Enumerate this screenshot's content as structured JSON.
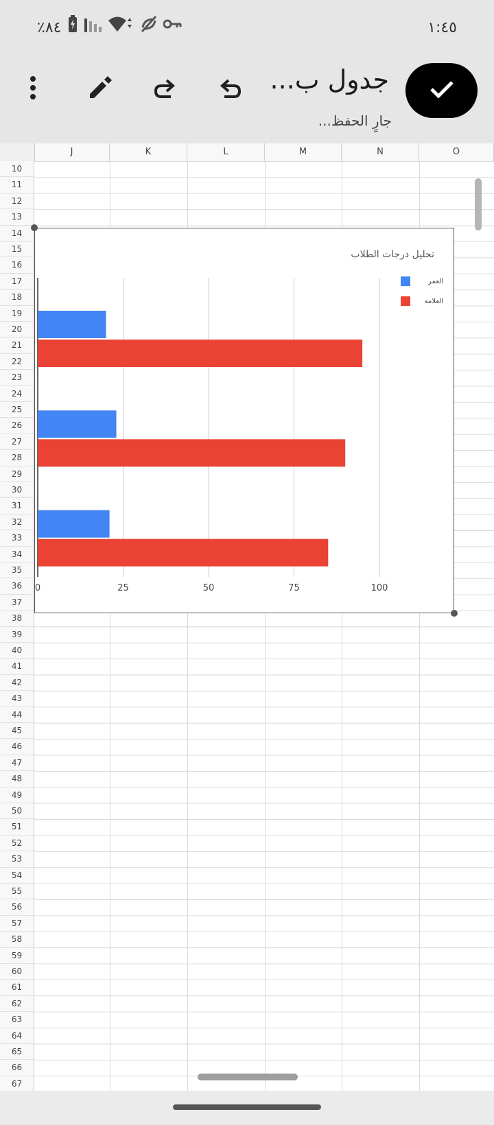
{
  "status_bar": {
    "battery_percent": "٨٤٪",
    "time": "١:٤٥"
  },
  "toolbar": {
    "title": "جدول ب...",
    "save_status": "جارٍ الحفظ...",
    "icons": [
      "more-vert-icon",
      "edit-pencil-icon",
      "redo-icon",
      "undo-icon",
      "check-icon"
    ]
  },
  "sheet": {
    "columns": [
      "J",
      "K",
      "L",
      "M",
      "N",
      "O"
    ],
    "rows": [
      "10",
      "11",
      "12",
      "13",
      "14",
      "15",
      "16",
      "17",
      "18",
      "19",
      "20",
      "21",
      "22",
      "23",
      "24",
      "25",
      "26",
      "27",
      "28",
      "29",
      "30",
      "31",
      "32",
      "33",
      "34",
      "35",
      "36",
      "37",
      "38",
      "39",
      "40",
      "41",
      "42",
      "43",
      "44",
      "45",
      "46",
      "47",
      "48",
      "49",
      "50",
      "51",
      "52",
      "53",
      "54",
      "55",
      "56",
      "57",
      "58",
      "59",
      "60",
      "61",
      "62",
      "63",
      "64",
      "65",
      "66",
      "67"
    ]
  },
  "chart_data": {
    "type": "bar",
    "orientation": "horizontal",
    "title": "تحليل درجات الطلاب",
    "xlim": [
      0,
      100
    ],
    "xticks": [
      "0",
      "25",
      "50",
      "75",
      "100"
    ],
    "grid": true,
    "legend_position": "top-right",
    "categories": [
      "",
      "",
      ""
    ],
    "series": [
      {
        "name": "العمر",
        "color": "#4285f4",
        "values": [
          20,
          23,
          21
        ]
      },
      {
        "name": "العلامة",
        "color": "#ea4335",
        "values": [
          95,
          90,
          85
        ]
      }
    ]
  }
}
